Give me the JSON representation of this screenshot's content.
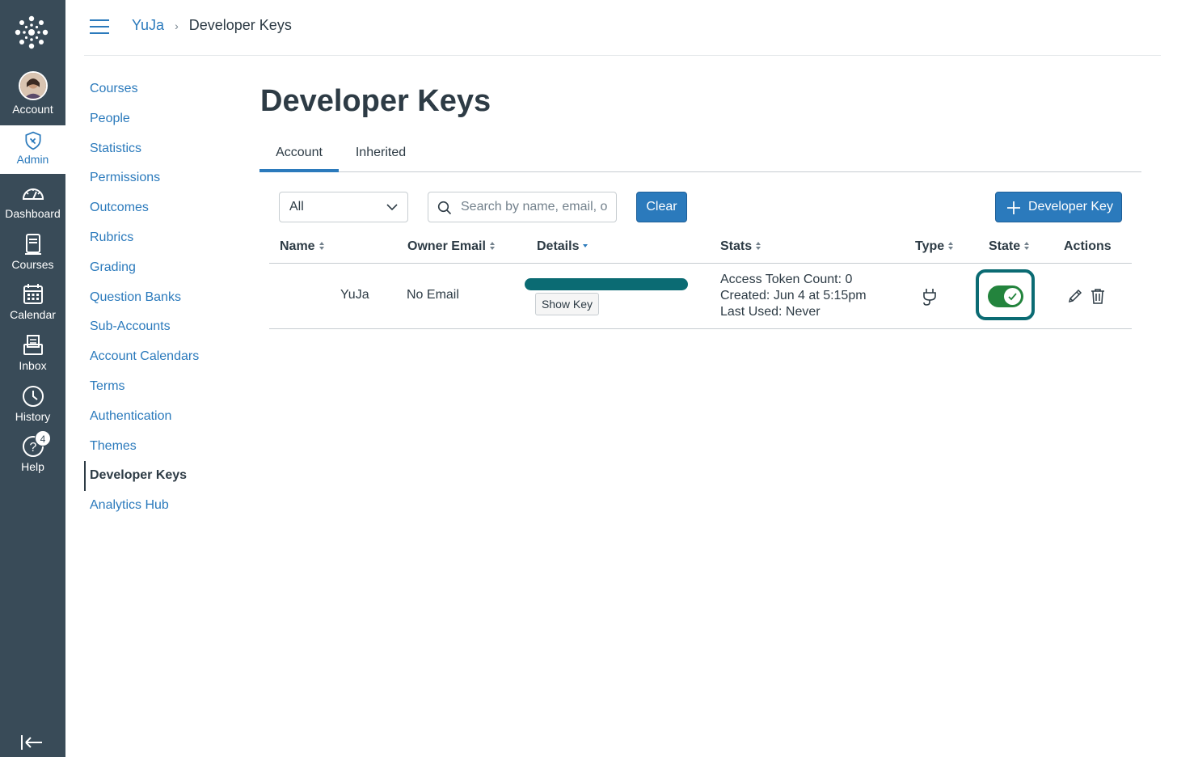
{
  "global_nav": {
    "items": [
      {
        "label": "Account",
        "icon": "avatar"
      },
      {
        "label": "Admin",
        "icon": "shield-icon"
      },
      {
        "label": "Dashboard",
        "icon": "dashboard-icon"
      },
      {
        "label": "Courses",
        "icon": "courses-icon"
      },
      {
        "label": "Calendar",
        "icon": "calendar-icon"
      },
      {
        "label": "Inbox",
        "icon": "inbox-icon"
      },
      {
        "label": "History",
        "icon": "clock-icon"
      },
      {
        "label": "Help",
        "icon": "help-icon"
      }
    ],
    "help_badge": "4",
    "colors": {
      "background": "#394b58",
      "active": "#2b7abc"
    }
  },
  "breadcrumb": {
    "root": "YuJa",
    "current": "Developer Keys"
  },
  "subnav": {
    "items": [
      "Courses",
      "People",
      "Statistics",
      "Permissions",
      "Outcomes",
      "Rubrics",
      "Grading",
      "Question Banks",
      "Sub-Accounts",
      "Account Calendars",
      "Terms",
      "Authentication",
      "Themes",
      "Developer Keys",
      "Analytics Hub"
    ],
    "active": "Developer Keys"
  },
  "page": {
    "title": "Developer Keys",
    "tabs": [
      {
        "label": "Account"
      },
      {
        "label": "Inherited"
      }
    ],
    "active_tab": "Account"
  },
  "filters": {
    "select_value": "All",
    "search_placeholder": "Search by name, email, or ID",
    "clear_label": "Clear",
    "add_label": "Developer Key"
  },
  "table": {
    "headers": [
      "Name",
      "Owner Email",
      "Details",
      "Stats",
      "Type",
      "State",
      "Actions"
    ],
    "rows": [
      {
        "name": "YuJa",
        "owner_email": "No Email",
        "show_key_label": "Show Key",
        "stats": [
          "Access Token Count: 0",
          "Created: Jun 4 at 5:15pm",
          "Last Used: Never"
        ],
        "type_icon": "plug-icon",
        "state": "on"
      }
    ]
  },
  "colors": {
    "accent": "#2b7abc",
    "toggle_on": "#23843d",
    "focus_ring": "#0b6b73"
  }
}
